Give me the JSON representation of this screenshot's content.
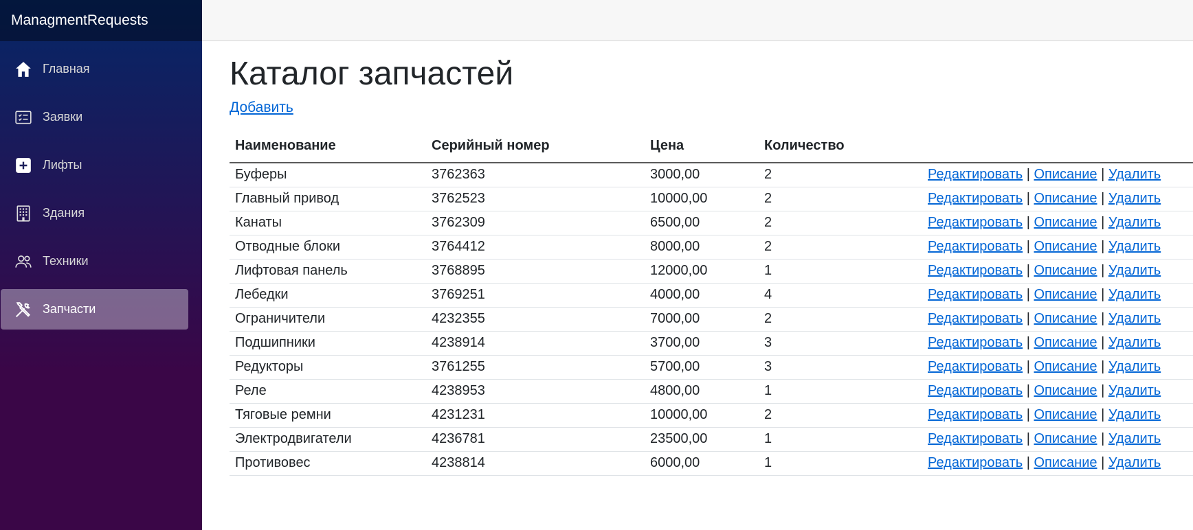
{
  "brand": "ManagmentRequests",
  "nav": [
    {
      "label": "Главная",
      "icon": "home-icon",
      "active": false
    },
    {
      "label": "Заявки",
      "icon": "list-icon",
      "active": false
    },
    {
      "label": "Лифты",
      "icon": "plus-square-icon",
      "active": false
    },
    {
      "label": "Здания",
      "icon": "building-icon",
      "active": false
    },
    {
      "label": "Техники",
      "icon": "people-icon",
      "active": false
    },
    {
      "label": "Запчасти",
      "icon": "tools-icon",
      "active": true
    }
  ],
  "page": {
    "title": "Каталог запчастей",
    "add_label": "Добавить"
  },
  "table": {
    "headers": {
      "name": "Наименование",
      "serial": "Серийный номер",
      "price": "Цена",
      "qty": "Количество"
    },
    "actions": {
      "edit": "Редактировать",
      "details": "Описание",
      "delete": "Удалить",
      "separator": "|"
    },
    "rows": [
      {
        "name": "Буферы",
        "serial": "3762363",
        "price": "3000,00",
        "qty": "2"
      },
      {
        "name": "Главный привод",
        "serial": "3762523",
        "price": "10000,00",
        "qty": "2"
      },
      {
        "name": "Канаты",
        "serial": "3762309",
        "price": "6500,00",
        "qty": "2"
      },
      {
        "name": "Отводные блоки",
        "serial": "3764412",
        "price": "8000,00",
        "qty": "2"
      },
      {
        "name": "Лифтовая панель",
        "serial": "3768895",
        "price": "12000,00",
        "qty": "1"
      },
      {
        "name": "Лебедки",
        "serial": "3769251",
        "price": "4000,00",
        "qty": "4"
      },
      {
        "name": "Ограничители",
        "serial": "4232355",
        "price": "7000,00",
        "qty": "2"
      },
      {
        "name": "Подшипники",
        "serial": "4238914",
        "price": "3700,00",
        "qty": "3"
      },
      {
        "name": "Редукторы",
        "serial": "3761255",
        "price": "5700,00",
        "qty": "3"
      },
      {
        "name": "Реле",
        "serial": "4238953",
        "price": "4800,00",
        "qty": "1"
      },
      {
        "name": "Тяговые ремни",
        "serial": "4231231",
        "price": "10000,00",
        "qty": "2"
      },
      {
        "name": "Электродвигатели",
        "serial": "4236781",
        "price": "23500,00",
        "qty": "1"
      },
      {
        "name": "Противовес",
        "serial": "4238814",
        "price": "6000,00",
        "qty": "1"
      }
    ]
  }
}
